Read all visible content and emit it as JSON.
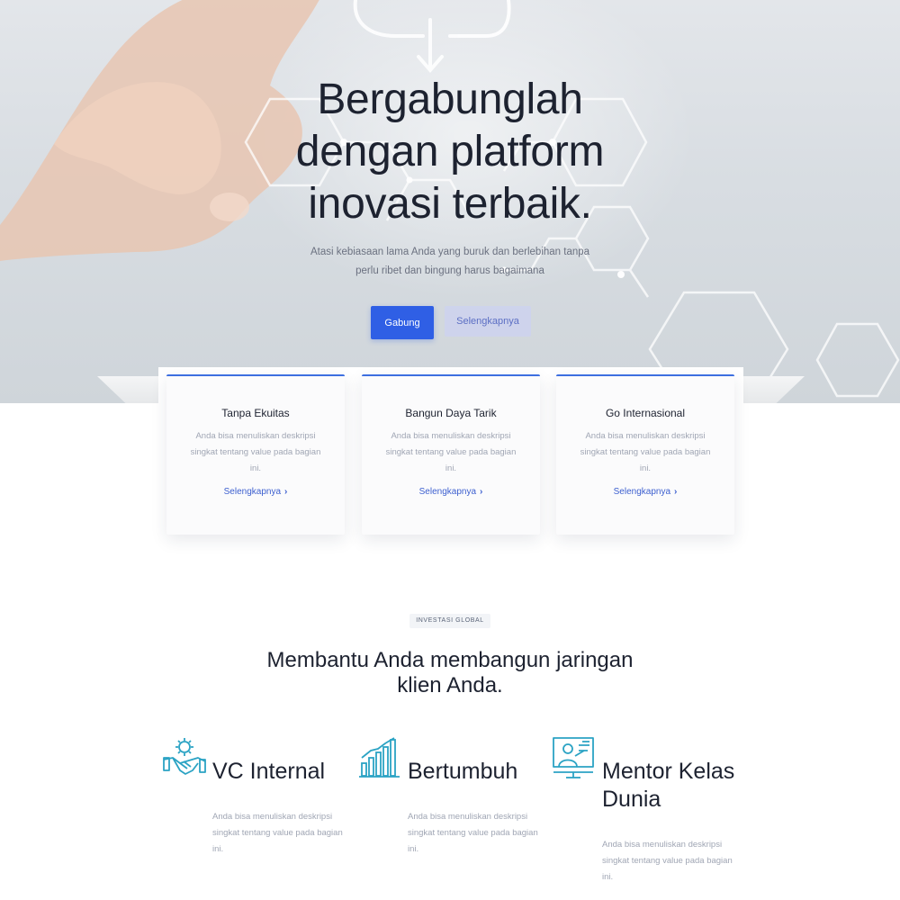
{
  "hero": {
    "title_lines": [
      "Bergabunglah",
      "dengan platform",
      "inovasi terbaik."
    ],
    "subtitle_lines": [
      "Atasi kebiasaan lama Anda yang buruk dan berlebihan tanpa",
      "perlu ribet dan bingung harus bagaimana"
    ],
    "primary_button": "Gabung",
    "secondary_button": "Selengkapnya"
  },
  "cards": [
    {
      "title": "Tanpa Ekuitas",
      "description": "Anda bisa menuliskan deskripsi singkat tentang value pada bagian ini.",
      "link": "Selengkapnya"
    },
    {
      "title": "Bangun Daya Tarik",
      "description": "Anda bisa menuliskan deskripsi singkat tentang value pada bagian ini.",
      "link": "Selengkapnya"
    },
    {
      "title": "Go Internasional",
      "description": "Anda bisa menuliskan deskripsi singkat tentang value pada bagian ini.",
      "link": "Selengkapnya"
    }
  ],
  "section": {
    "tag": "INVESTASI GLOBAL",
    "title": "Membantu Anda membangun jaringan klien Anda."
  },
  "features": [
    {
      "title": "VC Internal",
      "icon": "handshake-gear-icon",
      "description": "Anda bisa menuliskan deskripsi singkat tentang value pada bagian ini."
    },
    {
      "title": "Bertumbuh",
      "icon": "growth-chart-icon",
      "description": "Anda bisa menuliskan deskripsi singkat tentang value pada bagian ini."
    },
    {
      "title": "Mentor Kelas Dunia",
      "icon": "mentor-presentation-icon",
      "description": "Anda bisa menuliskan deskripsi singkat tentang value pada bagian ini."
    }
  ],
  "colors": {
    "primary": "#2f5fe5",
    "card_accent": "#3d6fe0",
    "icon_teal": "#2ba3c4",
    "heading": "#1d2230",
    "muted": "#a0a6b4"
  }
}
